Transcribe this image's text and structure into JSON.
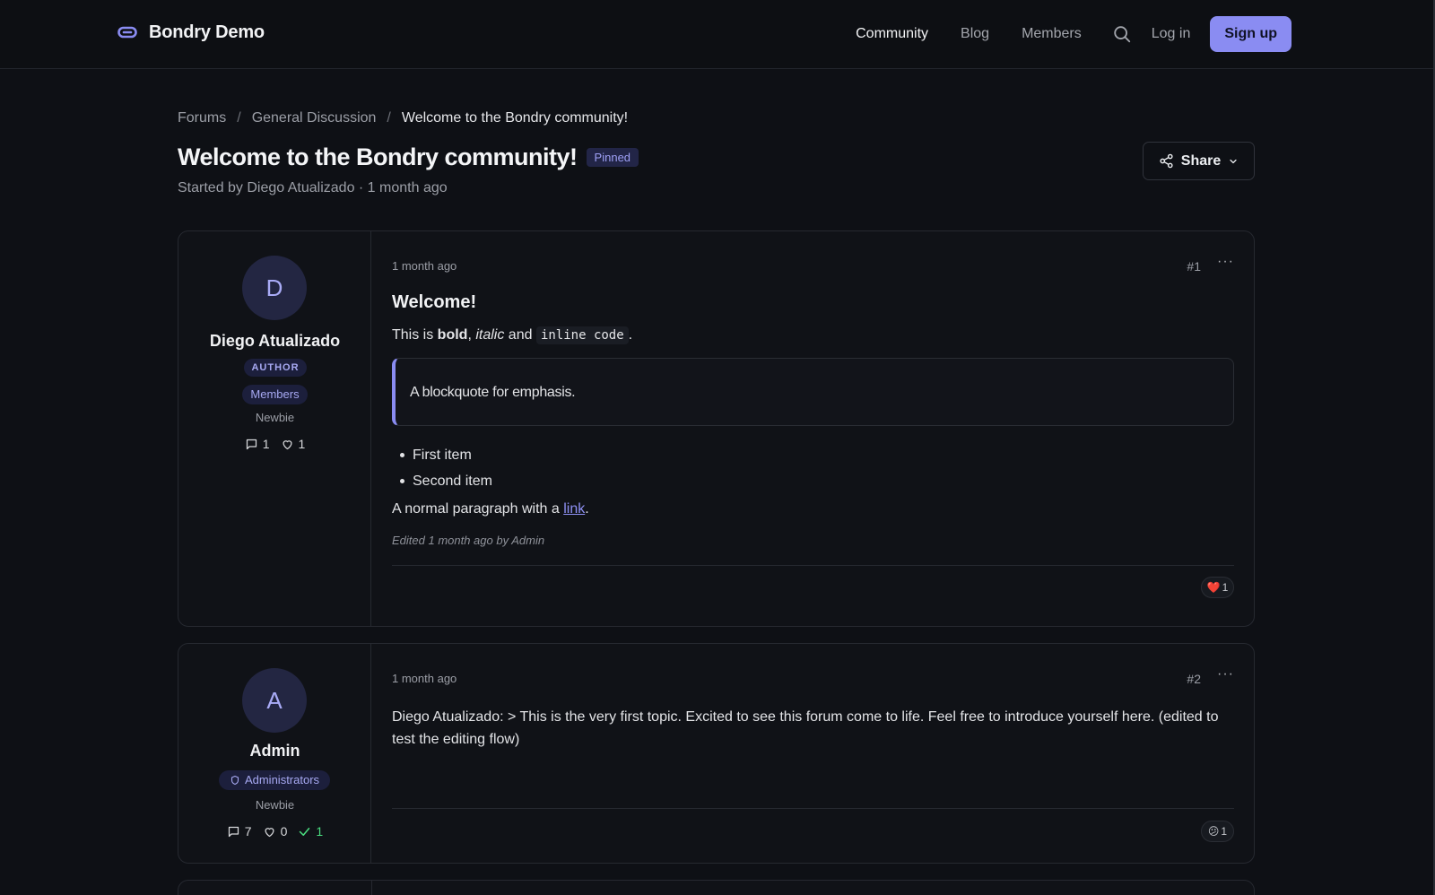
{
  "app": {
    "brand_name": "Bondry Demo",
    "accent_color": "#8a8cf2"
  },
  "nav": {
    "items": [
      {
        "label": "Community",
        "active": true
      },
      {
        "label": "Blog",
        "active": false
      },
      {
        "label": "Members",
        "active": false
      }
    ],
    "search_icon": "search-icon",
    "login_label": "Log in",
    "signup_label": "Sign up"
  },
  "breadcrumb": {
    "items": [
      "Forums",
      "General Discussion"
    ],
    "separator": "/",
    "current": "Welcome to the Bondry community!"
  },
  "topic": {
    "title": "Welcome to the Bondry community!",
    "badge": "Pinned",
    "subtitle": "Started by Diego Atualizado · 1 month ago",
    "share_label": "Share"
  },
  "posts": [
    {
      "avatar_letter": "D",
      "author": "Diego Atualizado",
      "role_badge": "AUTHOR",
      "group": "Members",
      "rank": "Newbie",
      "stats": {
        "comments": "1",
        "likes": "1"
      },
      "time": "1 month ago",
      "number": "#1",
      "heading": "Welcome!",
      "p1": {
        "prefix": "This is ",
        "bold": "bold",
        "comma": ", ",
        "italic": "italic",
        "and": " and ",
        "code": "inline code",
        "suffix": "."
      },
      "quote": "A blockquote for emphasis.",
      "list": [
        "First item",
        "Second item"
      ],
      "p2": {
        "prefix": "A normal paragraph with a ",
        "link": "link",
        "suffix": "."
      },
      "edited": "Edited 1 month ago by Admin",
      "reaction": {
        "emoji": "❤️",
        "count": "1"
      }
    },
    {
      "avatar_letter": "A",
      "author": "Admin",
      "group": "Administrators",
      "rank": "Newbie",
      "stats": {
        "comments": "7",
        "likes": "0",
        "solutions": "1"
      },
      "time": "1 month ago",
      "number": "#2",
      "text": "Diego Atualizado: > This is the very first topic. Excited to see this forum come to life. Feel free to introduce yourself here. (edited to test the editing flow)",
      "reaction": {
        "emoji": "😕",
        "count": "1"
      }
    }
  ]
}
